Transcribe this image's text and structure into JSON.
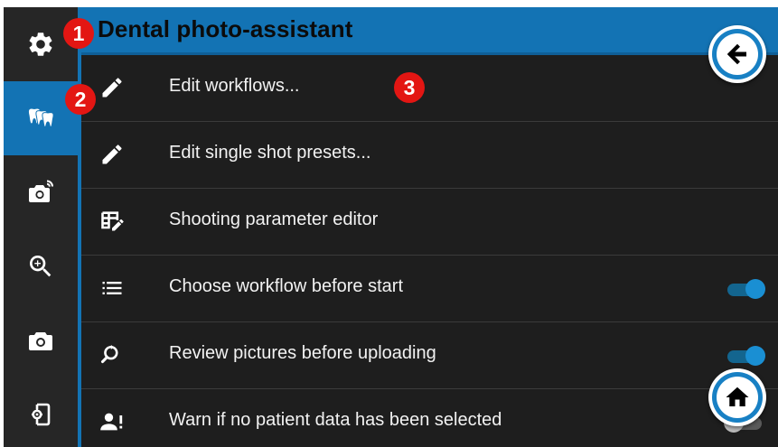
{
  "header": {
    "title": "Dental photo-assistant"
  },
  "sidebar": {
    "items": [
      {
        "icon": "gear-icon"
      },
      {
        "icon": "teeth-icon",
        "active": true
      },
      {
        "icon": "camera-wireless-icon"
      },
      {
        "icon": "zoom-in-icon"
      },
      {
        "icon": "camera-icon"
      },
      {
        "icon": "exit-settings-icon"
      }
    ]
  },
  "menu": {
    "items": [
      {
        "label": "Edit workflows...",
        "icon": "pencil-icon"
      },
      {
        "label": "Edit single shot presets...",
        "icon": "pencil-icon"
      },
      {
        "label": "Shooting parameter editor",
        "icon": "table-edit-icon"
      },
      {
        "label": "Choose workflow before start",
        "icon": "list-icon",
        "toggle": true
      },
      {
        "label": "Review pictures before uploading",
        "icon": "review-search-icon",
        "toggle": true
      },
      {
        "label": "Warn if no patient data has been selected",
        "icon": "patient-alert-icon",
        "toggle": false
      }
    ]
  },
  "badges": [
    "1",
    "2",
    "3"
  ],
  "colors": {
    "accent": "#1373b4",
    "background": "#1e1e1e",
    "sidebar": "#262626",
    "badge": "#e31613",
    "toggle_on": "#1a8fd3"
  }
}
